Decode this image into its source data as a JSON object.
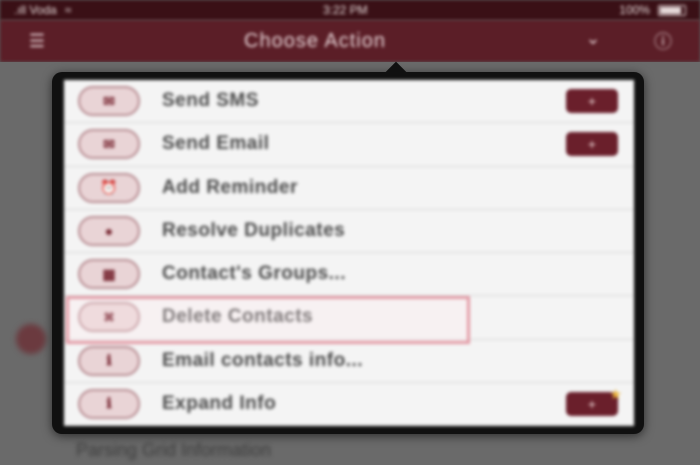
{
  "status_bar": {
    "carrier": ".ıll Voda",
    "wifi_icon": "wifi-icon",
    "time": "3:22 PM",
    "battery_percent": "100%"
  },
  "nav": {
    "title": "Choose Action",
    "left_icon": "menu-icon",
    "right_icons": [
      "chevron-down-icon",
      "info-icon"
    ]
  },
  "menu": {
    "items": [
      {
        "label": "Send SMS",
        "icon": "sms-icon",
        "badge": "+"
      },
      {
        "label": "Send Email",
        "icon": "email-icon",
        "badge": "+"
      },
      {
        "label": "Add Reminder",
        "icon": "reminder-icon",
        "badge": ""
      },
      {
        "label": "Resolve Duplicates",
        "icon": "duplicates-icon",
        "badge": ""
      },
      {
        "label": "Contact's Groups...",
        "icon": "groups-icon",
        "badge": ""
      },
      {
        "label": "Delete Contacts",
        "icon": "delete-icon",
        "badge": ""
      },
      {
        "label": "Email contacts info...",
        "icon": "info-icon",
        "badge": ""
      },
      {
        "label": "Expand Info",
        "icon": "expand-icon",
        "badge": "+"
      }
    ],
    "highlighted_item": "Delete Contacts"
  },
  "background": {
    "text": "Parsing Grid Information"
  },
  "colors": {
    "brand": "#5b1e27",
    "badge": "#6a1f2b",
    "highlight": "#e39aa5"
  }
}
